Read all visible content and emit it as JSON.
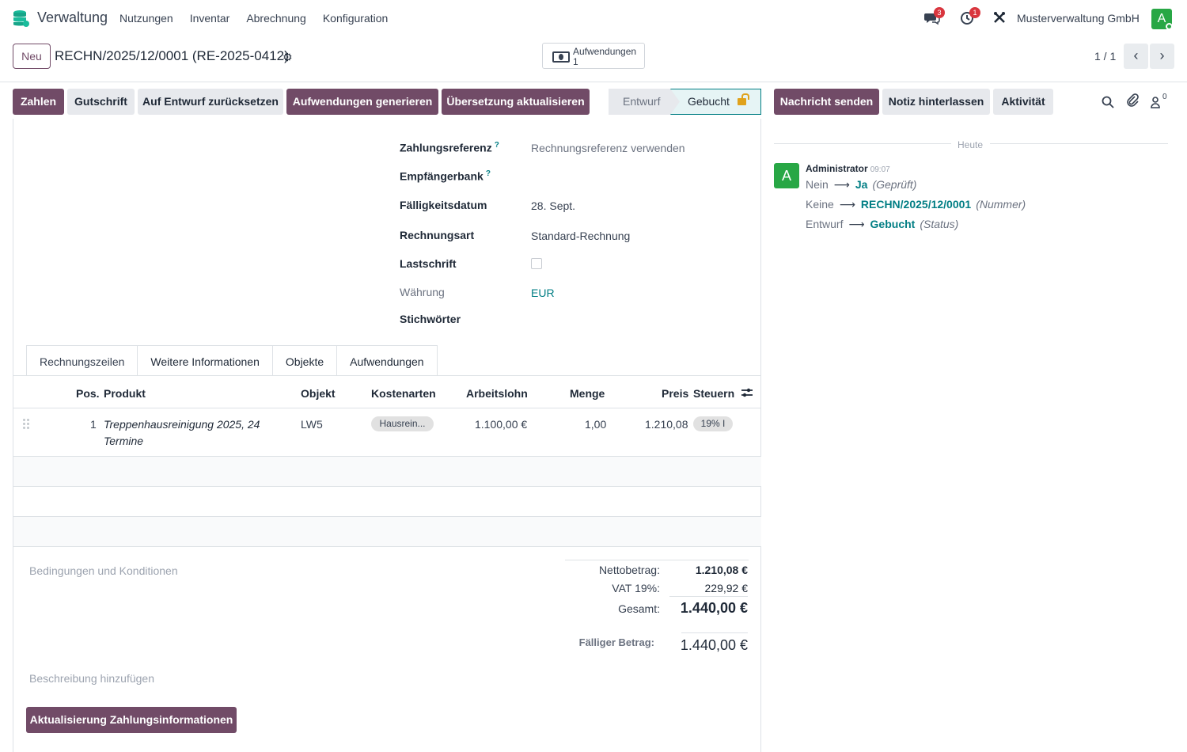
{
  "app": {
    "name": "Verwaltung"
  },
  "menu": [
    "Nutzungen",
    "Inventar",
    "Abrechnung",
    "Konfiguration"
  ],
  "systray": {
    "messages_count": "3",
    "activities_count": "1",
    "company": "Musterverwaltung GmbH",
    "user_initial": "A"
  },
  "control": {
    "new_label": "Neu",
    "record_title": "RECHN/2025/12/0001 (RE-2025-0412)",
    "smart_button": {
      "label": "Aufwendungen",
      "count": "1"
    },
    "pager": "1 / 1"
  },
  "actions": [
    "Zahlen",
    "Gutschrift",
    "Auf Entwurf zurücksetzen",
    "Aufwendungen generieren",
    "Übersetzung aktualisieren"
  ],
  "status": {
    "draft": "Entwurf",
    "posted": "Gebucht"
  },
  "form": {
    "payment_ref_label": "Zahlungsreferenz",
    "payment_ref_placeholder": "Rechnungsreferenz verwenden",
    "bank_label": "Empfängerbank",
    "due_label": "Fälligkeitsdatum",
    "due_value": "28. Sept.",
    "type_label": "Rechnungsart",
    "type_value": "Standard-Rechnung",
    "debit_label": "Lastschrift",
    "currency_label": "Währung",
    "currency_value": "EUR",
    "tags_label": "Stichwörter"
  },
  "tabs": [
    "Rechnungszeilen",
    "Weitere Informationen",
    "Objekte",
    "Aufwendungen"
  ],
  "table": {
    "headers": {
      "pos": "Pos.",
      "product": "Produkt",
      "object": "Objekt",
      "cost": "Kostenarten",
      "labor": "Arbeitslohn",
      "qty": "Menge",
      "price": "Preis",
      "tax": "Steuern"
    },
    "rows": [
      {
        "pos": "1",
        "product_line1": "Treppenhausreinigung 2025, 24",
        "product_line2": "Termine",
        "object": "LW5",
        "cost": "Hausrein...",
        "labor": "1.100,00 €",
        "qty": "1,00",
        "price": "1.210,08",
        "tax": "19% I"
      }
    ]
  },
  "footer": {
    "terms_placeholder": "Bedingungen und Konditionen",
    "desc_placeholder": "Beschreibung hinzufügen",
    "net_label": "Nettobetrag:",
    "net_value": "1.210,08 €",
    "vat_label": "VAT 19%:",
    "vat_value": "229,92 €",
    "total_label": "Gesamt:",
    "total_value": "1.440,00 €",
    "due_label": "Fälliger Betrag:",
    "due_value": "1.440,00 €",
    "update_button": "Aktualisierung Zahlungsinformationen"
  },
  "chatter": {
    "send_message": "Nachricht senden",
    "log_note": "Notiz hinterlassen",
    "activity": "Aktivität",
    "followers_count": "0",
    "today": "Heute",
    "author": "Administrator",
    "time": "09:07",
    "author_initial": "A",
    "tracking": [
      {
        "old": "Nein",
        "new": "Ja",
        "field": "(Geprüft)"
      },
      {
        "old": "Keine",
        "new": "RECHN/2025/12/0001",
        "field": "(Nummer)"
      },
      {
        "old": "Entwurf",
        "new": "Gebucht",
        "field": "(Status)"
      }
    ]
  },
  "colors": {
    "primary": "#714b67",
    "accent": "#017e84",
    "avatar": "#28a745",
    "badge": "#d9363e"
  }
}
